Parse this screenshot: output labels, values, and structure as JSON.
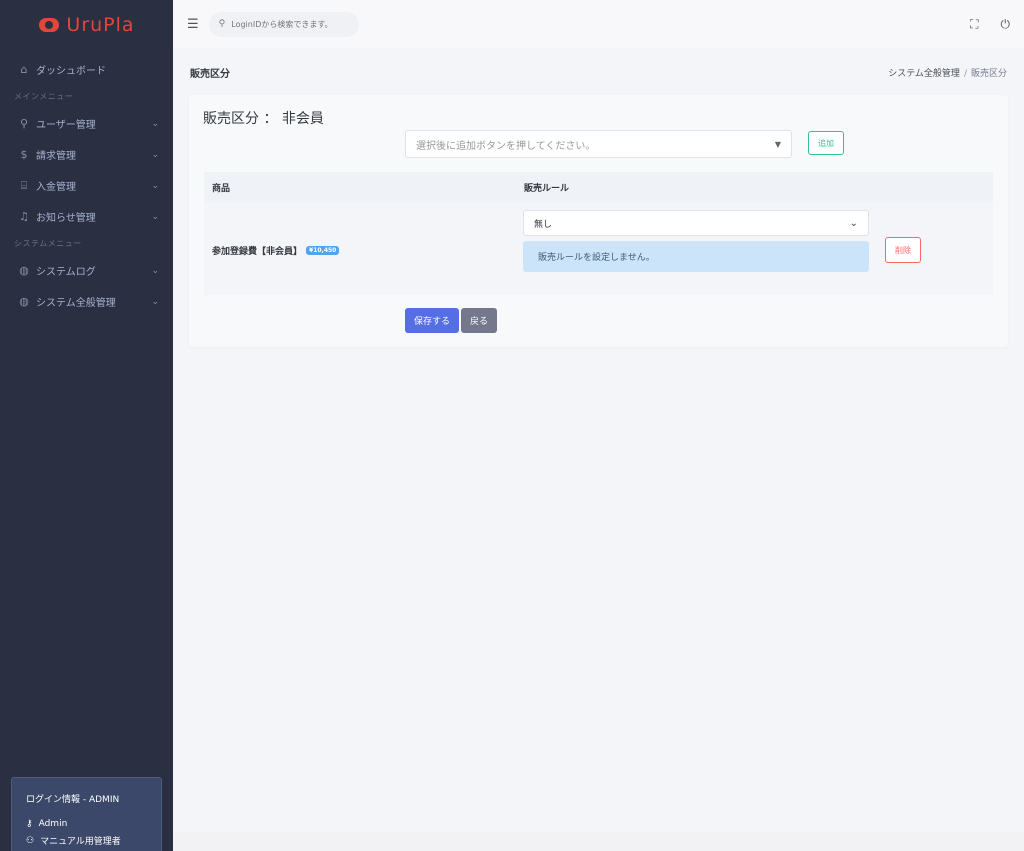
{
  "app": {
    "logo_text": "UruPla",
    "brand_color": "#e0473a"
  },
  "sidebar": {
    "dashboard": {
      "label": "ダッシュボード",
      "icon": "home-icon"
    },
    "main_menu_title": "メインメニュー",
    "main_items": [
      {
        "label": "ユーザー管理",
        "icon": "user-icon"
      },
      {
        "label": "請求管理",
        "icon": "dollar-icon"
      },
      {
        "label": "入金管理",
        "icon": "bank-icon"
      },
      {
        "label": "お知らせ管理",
        "icon": "bell-icon"
      }
    ],
    "system_menu_title": "システムメニュー",
    "system_items": [
      {
        "label": "システムログ",
        "icon": "globe-icon"
      },
      {
        "label": "システム全般管理",
        "icon": "globe-icon"
      }
    ],
    "login_info": {
      "title": "ログイン情報 - ADMIN",
      "user": "Admin",
      "role": "マニュアル用管理者"
    }
  },
  "topbar": {
    "search_placeholder": "LoginIDから検索できます。"
  },
  "page": {
    "title": "販売区分",
    "breadcrumb": [
      "システム全般管理",
      "販売区分"
    ]
  },
  "card": {
    "title": "販売区分 ： 非会員",
    "select_placeholder": "選択後に追加ボタンを押してください。",
    "add_label": "追加",
    "table": {
      "headers": [
        "商品",
        "販売ルール"
      ],
      "row": {
        "product": "参加登録費【非会員】",
        "price": "¥10,450",
        "rule_selected": "無し",
        "rule_info": "販売ルールを設定しません。",
        "delete_label": "削除"
      }
    },
    "save_label": "保存する",
    "back_label": "戻る"
  },
  "colors": {
    "sidebar_bg": "#2a3042",
    "primary": "#556ee6",
    "success": "#34c38f",
    "danger": "#f46a6a",
    "info_bg": "#cce4f9"
  }
}
